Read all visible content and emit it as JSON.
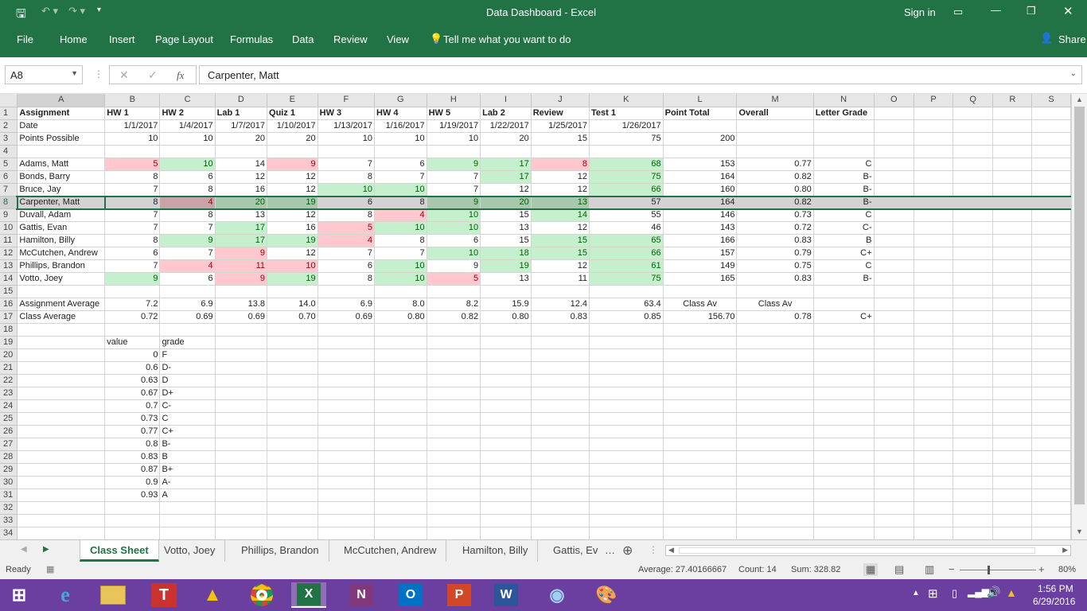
{
  "window": {
    "title": "Data Dashboard - Excel",
    "sign_in": "Sign in"
  },
  "ribbon": {
    "tabs": [
      "File",
      "Home",
      "Insert",
      "Page Layout",
      "Formulas",
      "Data",
      "Review",
      "View"
    ],
    "tell_me": "Tell me what you want to do",
    "share": "Share"
  },
  "formula_bar": {
    "name_box": "A8",
    "formula": "Carpenter, Matt",
    "fx": "fx"
  },
  "columns": [
    "A",
    "B",
    "C",
    "D",
    "E",
    "F",
    "G",
    "H",
    "I",
    "J",
    "K",
    "L",
    "M",
    "N",
    "O",
    "P",
    "Q",
    "R",
    "S"
  ],
  "rows": [
    {
      "n": "1",
      "cells": [
        "Assignment",
        "HW 1",
        "HW 2",
        "Lab 1",
        "Quiz 1",
        "HW 3",
        "HW 4",
        "HW 5",
        "Lab 2",
        "Review",
        "Test 1",
        "Point Total",
        "Overall",
        "Letter Grade",
        "",
        "",
        "",
        "",
        ""
      ]
    },
    {
      "n": "2",
      "cells": [
        "Date",
        "1/1/2017",
        "1/4/2017",
        "1/7/2017",
        "1/10/2017",
        "1/13/2017",
        "1/16/2017",
        "1/19/2017",
        "1/22/2017",
        "1/25/2017",
        "1/26/2017",
        "",
        "",
        "",
        "",
        "",
        "",
        "",
        ""
      ]
    },
    {
      "n": "3",
      "cells": [
        "Points Possible",
        "10",
        "10",
        "20",
        "20",
        "10",
        "10",
        "10",
        "20",
        "15",
        "75",
        "200",
        "",
        "",
        "",
        "",
        "",
        "",
        ""
      ]
    },
    {
      "n": "4",
      "cells": [
        "",
        "",
        "",
        "",
        "",
        "",
        "",
        "",
        "",
        "",
        "",
        "",
        "",
        "",
        "",
        "",
        "",
        "",
        ""
      ]
    },
    {
      "n": "5",
      "cells": [
        "Adams, Matt",
        "5",
        "10",
        "14",
        "9",
        "7",
        "6",
        "9",
        "17",
        "8",
        "68",
        "153",
        "0.77",
        "C",
        "",
        "",
        "",
        "",
        ""
      ]
    },
    {
      "n": "6",
      "cells": [
        "Bonds, Barry",
        "8",
        "6",
        "12",
        "12",
        "8",
        "7",
        "7",
        "17",
        "12",
        "75",
        "164",
        "0.82",
        "B-",
        "",
        "",
        "",
        "",
        ""
      ]
    },
    {
      "n": "7",
      "cells": [
        "Bruce, Jay",
        "7",
        "8",
        "16",
        "12",
        "10",
        "10",
        "7",
        "12",
        "12",
        "66",
        "160",
        "0.80",
        "B-",
        "",
        "",
        "",
        "",
        ""
      ]
    },
    {
      "n": "8",
      "cells": [
        "Carpenter, Matt",
        "8",
        "4",
        "20",
        "19",
        "6",
        "8",
        "9",
        "20",
        "13",
        "57",
        "164",
        "0.82",
        "B-",
        "",
        "",
        "",
        "",
        ""
      ]
    },
    {
      "n": "9",
      "cells": [
        "Duvall, Adam",
        "7",
        "8",
        "13",
        "12",
        "8",
        "4",
        "10",
        "15",
        "14",
        "55",
        "146",
        "0.73",
        "C",
        "",
        "",
        "",
        "",
        ""
      ]
    },
    {
      "n": "10",
      "cells": [
        "Gattis, Evan",
        "7",
        "7",
        "17",
        "16",
        "5",
        "10",
        "10",
        "13",
        "12",
        "46",
        "143",
        "0.72",
        "C-",
        "",
        "",
        "",
        "",
        ""
      ]
    },
    {
      "n": "11",
      "cells": [
        "Hamilton, Billy",
        "8",
        "9",
        "17",
        "19",
        "4",
        "8",
        "6",
        "15",
        "15",
        "65",
        "166",
        "0.83",
        "B",
        "",
        "",
        "",
        "",
        ""
      ]
    },
    {
      "n": "12",
      "cells": [
        "McCutchen, Andrew",
        "6",
        "7",
        "9",
        "12",
        "7",
        "7",
        "10",
        "18",
        "15",
        "66",
        "157",
        "0.79",
        "C+",
        "",
        "",
        "",
        "",
        ""
      ]
    },
    {
      "n": "13",
      "cells": [
        "Phillips, Brandon",
        "7",
        "4",
        "11",
        "10",
        "6",
        "10",
        "9",
        "19",
        "12",
        "61",
        "149",
        "0.75",
        "C",
        "",
        "",
        "",
        "",
        ""
      ]
    },
    {
      "n": "14",
      "cells": [
        "Votto, Joey",
        "9",
        "6",
        "9",
        "19",
        "8",
        "10",
        "5",
        "13",
        "11",
        "75",
        "165",
        "0.83",
        "B-",
        "",
        "",
        "",
        "",
        ""
      ]
    },
    {
      "n": "15",
      "cells": [
        "",
        "",
        "",
        "",
        "",
        "",
        "",
        "",
        "",
        "",
        "",
        "",
        "",
        "",
        "",
        "",
        "",
        "",
        ""
      ]
    },
    {
      "n": "16",
      "cells": [
        "Assignment Average",
        "7.2",
        "6.9",
        "13.8",
        "14.0",
        "6.9",
        "8.0",
        "8.2",
        "15.9",
        "12.4",
        "63.4",
        "Class Av",
        "Class Av",
        "",
        "",
        "",
        "",
        "",
        ""
      ]
    },
    {
      "n": "17",
      "cells": [
        "Class Average",
        "0.72",
        "0.69",
        "0.69",
        "0.70",
        "0.69",
        "0.80",
        "0.82",
        "0.80",
        "0.83",
        "0.85",
        "156.70",
        "0.78",
        "C+",
        "",
        "",
        "",
        "",
        ""
      ]
    },
    {
      "n": "18",
      "cells": [
        "",
        "",
        "",
        "",
        "",
        "",
        "",
        "",
        "",
        "",
        "",
        "",
        "",
        "",
        "",
        "",
        "",
        "",
        ""
      ]
    },
    {
      "n": "19",
      "cells": [
        "",
        "value",
        "grade",
        "",
        "",
        "",
        "",
        "",
        "",
        "",
        "",
        "",
        "",
        "",
        "",
        "",
        "",
        "",
        ""
      ]
    },
    {
      "n": "20",
      "cells": [
        "",
        "0",
        "F",
        "",
        "",
        "",
        "",
        "",
        "",
        "",
        "",
        "",
        "",
        "",
        "",
        "",
        "",
        "",
        ""
      ]
    },
    {
      "n": "21",
      "cells": [
        "",
        "0.6",
        "D-",
        "",
        "",
        "",
        "",
        "",
        "",
        "",
        "",
        "",
        "",
        "",
        "",
        "",
        "",
        "",
        ""
      ]
    },
    {
      "n": "22",
      "cells": [
        "",
        "0.63",
        "D",
        "",
        "",
        "",
        "",
        "",
        "",
        "",
        "",
        "",
        "",
        "",
        "",
        "",
        "",
        "",
        ""
      ]
    },
    {
      "n": "23",
      "cells": [
        "",
        "0.67",
        "D+",
        "",
        "",
        "",
        "",
        "",
        "",
        "",
        "",
        "",
        "",
        "",
        "",
        "",
        "",
        "",
        ""
      ]
    },
    {
      "n": "24",
      "cells": [
        "",
        "0.7",
        "C-",
        "",
        "",
        "",
        "",
        "",
        "",
        "",
        "",
        "",
        "",
        "",
        "",
        "",
        "",
        "",
        ""
      ]
    },
    {
      "n": "25",
      "cells": [
        "",
        "0.73",
        "C",
        "",
        "",
        "",
        "",
        "",
        "",
        "",
        "",
        "",
        "",
        "",
        "",
        "",
        "",
        "",
        ""
      ]
    },
    {
      "n": "26",
      "cells": [
        "",
        "0.77",
        "C+",
        "",
        "",
        "",
        "",
        "",
        "",
        "",
        "",
        "",
        "",
        "",
        "",
        "",
        "",
        "",
        ""
      ]
    },
    {
      "n": "27",
      "cells": [
        "",
        "0.8",
        "B-",
        "",
        "",
        "",
        "",
        "",
        "",
        "",
        "",
        "",
        "",
        "",
        "",
        "",
        "",
        "",
        ""
      ]
    },
    {
      "n": "28",
      "cells": [
        "",
        "0.83",
        "B",
        "",
        "",
        "",
        "",
        "",
        "",
        "",
        "",
        "",
        "",
        "",
        "",
        "",
        "",
        "",
        ""
      ]
    },
    {
      "n": "29",
      "cells": [
        "",
        "0.87",
        "B+",
        "",
        "",
        "",
        "",
        "",
        "",
        "",
        "",
        "",
        "",
        "",
        "",
        "",
        "",
        "",
        ""
      ]
    },
    {
      "n": "30",
      "cells": [
        "",
        "0.9",
        "A-",
        "",
        "",
        "",
        "",
        "",
        "",
        "",
        "",
        "",
        "",
        "",
        "",
        "",
        "",
        "",
        ""
      ]
    },
    {
      "n": "31",
      "cells": [
        "",
        "0.93",
        "A",
        "",
        "",
        "",
        "",
        "",
        "",
        "",
        "",
        "",
        "",
        "",
        "",
        "",
        "",
        "",
        ""
      ]
    },
    {
      "n": "32",
      "cells": [
        "",
        "",
        "",
        "",
        "",
        "",
        "",
        "",
        "",
        "",
        "",
        "",
        "",
        "",
        "",
        "",
        "",
        "",
        ""
      ]
    },
    {
      "n": "33",
      "cells": [
        "",
        "",
        "",
        "",
        "",
        "",
        "",
        "",
        "",
        "",
        "",
        "",
        "",
        "",
        "",
        "",
        "",
        "",
        ""
      ]
    },
    {
      "n": "34",
      "cells": [
        "",
        "",
        "",
        "",
        "",
        "",
        "",
        "",
        "",
        "",
        "",
        "",
        "",
        "",
        "",
        "",
        "",
        "",
        ""
      ]
    }
  ],
  "sheet_tabs": [
    "Class Sheet",
    "Votto, Joey",
    "Phillips, Brandon",
    "McCutchen, Andrew",
    "Hamilton, Billy",
    "Gattis, Ev"
  ],
  "status": {
    "ready": "Ready",
    "average": "Average: 27.40166667",
    "count": "Count: 14",
    "sum": "Sum: 328.82",
    "zoom": "80%"
  },
  "taskbar": {
    "time": "1:56 PM",
    "date": "6/29/2016"
  },
  "colors": {
    "excel_green": "#217346",
    "bad_fill": "#ffc7ce",
    "good_fill": "#c6efce",
    "taskbar": "#6b3fa0"
  }
}
